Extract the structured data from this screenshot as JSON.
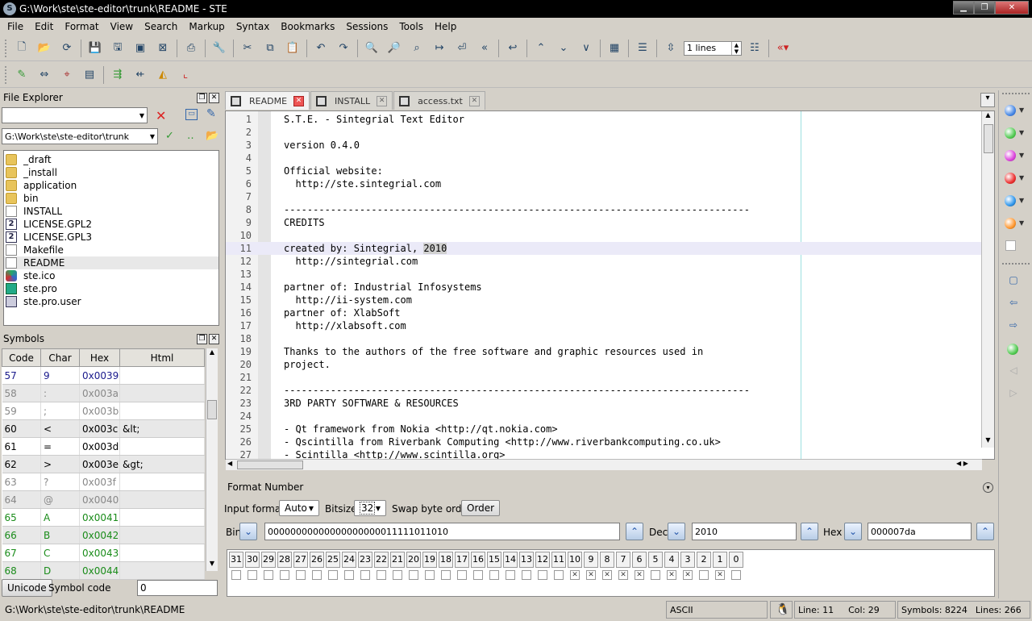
{
  "window": {
    "title": "G:\\Work\\ste\\ste-editor\\trunk\\README - STE",
    "app_icon": "S"
  },
  "menu": [
    "File",
    "Edit",
    "Format",
    "View",
    "Search",
    "Markup",
    "Syntax",
    "Bookmarks",
    "Sessions",
    "Tools",
    "Help"
  ],
  "toolbar": {
    "lines_value": "1 lines"
  },
  "file_explorer": {
    "title": "File Explorer",
    "filter_value": "",
    "path": "G:\\Work\\ste\\ste-editor\\trunk",
    "items": [
      {
        "name": "_draft",
        "icon": "folder-icon"
      },
      {
        "name": "_install",
        "icon": "folder-icon"
      },
      {
        "name": "application",
        "icon": "folder-icon"
      },
      {
        "name": "bin",
        "icon": "folder-icon"
      },
      {
        "name": "INSTALL",
        "icon": "file-icon"
      },
      {
        "name": "LICENSE.GPL2",
        "icon": "gpl-file-icon"
      },
      {
        "name": "LICENSE.GPL3",
        "icon": "gpl-file-icon"
      },
      {
        "name": "Makefile",
        "icon": "file-icon"
      },
      {
        "name": "README",
        "icon": "file-icon"
      },
      {
        "name": "ste.ico",
        "icon": "ico-file-icon"
      },
      {
        "name": "ste.pro",
        "icon": "pro-file-icon"
      },
      {
        "name": "ste.pro.user",
        "icon": "user-file-icon"
      }
    ],
    "selected": "README"
  },
  "symbols": {
    "title": "Symbols",
    "columns": [
      "Code",
      "Char",
      "Hex",
      "Html"
    ],
    "rows": [
      {
        "code": "57",
        "char": "9",
        "hex": "0x0039",
        "html": "",
        "color": "#1a1a8c"
      },
      {
        "code": "58",
        "char": ":",
        "hex": "0x003a",
        "html": "",
        "color": "#888888"
      },
      {
        "code": "59",
        "char": ";",
        "hex": "0x003b",
        "html": "",
        "color": "#888888"
      },
      {
        "code": "60",
        "char": "<",
        "hex": "0x003c",
        "html": "&lt;",
        "color": "#000000"
      },
      {
        "code": "61",
        "char": "=",
        "hex": "0x003d",
        "html": "",
        "color": "#000000"
      },
      {
        "code": "62",
        "char": ">",
        "hex": "0x003e",
        "html": "&gt;",
        "color": "#000000"
      },
      {
        "code": "63",
        "char": "?",
        "hex": "0x003f",
        "html": "",
        "color": "#888888"
      },
      {
        "code": "64",
        "char": "@",
        "hex": "0x0040",
        "html": "",
        "color": "#888888"
      },
      {
        "code": "65",
        "char": "A",
        "hex": "0x0041",
        "html": "",
        "color": "#1a8c1a"
      },
      {
        "code": "66",
        "char": "B",
        "hex": "0x0042",
        "html": "",
        "color": "#1a8c1a"
      },
      {
        "code": "67",
        "char": "C",
        "hex": "0x0043",
        "html": "",
        "color": "#1a8c1a"
      },
      {
        "code": "68",
        "char": "D",
        "hex": "0x0044",
        "html": "",
        "color": "#1a8c1a"
      }
    ],
    "unicode_button": "Unicode",
    "symbol_code_label": "Symbol code",
    "symbol_code_value": "0"
  },
  "tabs": [
    {
      "label": "README",
      "active": true
    },
    {
      "label": "INSTALL",
      "active": false
    },
    {
      "label": "access.txt",
      "active": false
    }
  ],
  "editor": {
    "current_line": 11,
    "lines": [
      "S.T.E. - Sintegrial Text Editor",
      "",
      "version 0.4.0",
      "",
      "Official website:",
      "  http://ste.sintegrial.com",
      "",
      "--------------------------------------------------------------------------------",
      "CREDITS",
      "",
      "created by: Sintegrial, ",
      "  http://sintegrial.com",
      "",
      "partner of: Industrial Infosystems",
      "  http://ii-system.com",
      "partner of: XlabSoft",
      "  http://xlabsoft.com",
      "",
      "Thanks to the authors of the free software and graphic resources used in",
      "project.",
      "",
      "--------------------------------------------------------------------------------",
      "3RD PARTY SOFTWARE & RESOURCES",
      "",
      "- Qt framework from Nokia <http://qt.nokia.com>",
      "- Qscintilla from Riverbank Computing <http://www.riverbankcomputing.co.uk>",
      "- Scintilla <http://www.scintilla.org>"
    ],
    "highlight": "2010"
  },
  "format_number": {
    "title": "Format Number",
    "input_format_label": "Input format",
    "input_format_value": "Auto",
    "bitsize_label": "Bitsize",
    "bitsize_value": "32",
    "swap_label": "Swap byte order",
    "order_button": "Order",
    "bin_label": "Bin",
    "bin_value": "00000000000000000000011111011010",
    "dec_label": "Dec",
    "dec_value": "2010",
    "hex_label": "Hex",
    "hex_value": "000007da",
    "bits": [
      "31",
      "30",
      "29",
      "28",
      "27",
      "26",
      "25",
      "24",
      "23",
      "22",
      "21",
      "20",
      "19",
      "18",
      "17",
      "16",
      "15",
      "14",
      "13",
      "12",
      "11",
      "10",
      "9",
      "8",
      "7",
      "6",
      "5",
      "4",
      "3",
      "2",
      "1",
      "0"
    ],
    "bit_values": [
      0,
      0,
      0,
      0,
      0,
      0,
      0,
      0,
      0,
      0,
      0,
      0,
      0,
      0,
      0,
      0,
      0,
      0,
      0,
      0,
      0,
      1,
      1,
      1,
      1,
      1,
      0,
      1,
      1,
      0,
      1,
      0
    ]
  },
  "status": {
    "path": "G:\\Work\\ste\\ste-editor\\trunk\\README",
    "encoding": "ASCII",
    "line": "Line: 11",
    "col": "Col: 29",
    "symbols": "Symbols: 8224",
    "lines": "Lines: 266"
  },
  "colors": {
    "accent": "#2a5db0",
    "current_line": "#ebeaf8",
    "close_red": "#e55555"
  }
}
